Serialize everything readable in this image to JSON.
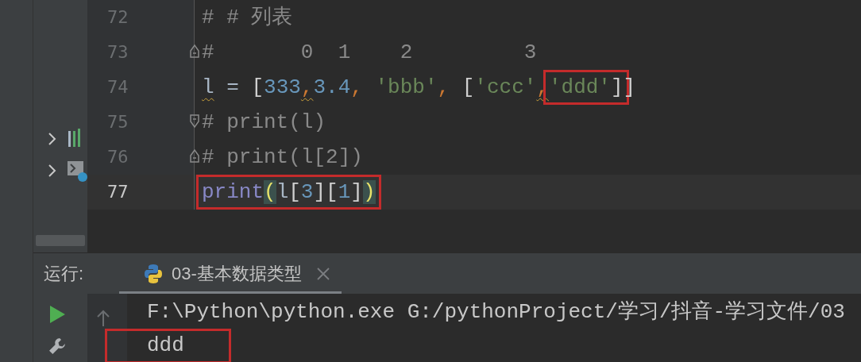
{
  "project_pane": {
    "rows": [
      {
        "kind": "chart",
        "expanded": false
      },
      {
        "kind": "console",
        "expanded": false
      }
    ]
  },
  "editor": {
    "lines": [
      {
        "number": "72",
        "current": false,
        "fold_start": false,
        "fold_end": false,
        "segments": [
          {
            "boxed": false,
            "tokens": [
              {
                "text": "# # 列表",
                "kind": "comment"
              }
            ]
          }
        ]
      },
      {
        "number": "73",
        "current": false,
        "fold_start": true,
        "fold_end": false,
        "segments": [
          {
            "boxed": false,
            "tokens": [
              {
                "text": "#       0  1    2         3",
                "kind": "comment"
              }
            ]
          }
        ]
      },
      {
        "number": "74",
        "current": false,
        "fold_start": false,
        "fold_end": false,
        "segments": [
          {
            "boxed": false,
            "tokens": [
              {
                "text": "l",
                "kind": "ident",
                "warning": true
              },
              {
                "text": " = ",
                "kind": "op"
              },
              {
                "text": "[",
                "kind": "bracket"
              },
              {
                "text": "333",
                "kind": "number"
              },
              {
                "text": ",",
                "kind": "comma",
                "warning": true
              },
              {
                "text": "3.4",
                "kind": "number"
              },
              {
                "text": ", ",
                "kind": "comma"
              },
              {
                "text": "'bbb'",
                "kind": "string"
              },
              {
                "text": ", ",
                "kind": "comma"
              },
              {
                "text": "[",
                "kind": "bracket"
              },
              {
                "text": "'ccc'",
                "kind": "string"
              },
              {
                "text": ",",
                "kind": "comma",
                "warning": true
              }
            ]
          },
          {
            "boxed": true,
            "tokens": [
              {
                "text": "'ddd'",
                "kind": "string"
              },
              {
                "text": "]",
                "kind": "bracket"
              }
            ]
          },
          {
            "boxed": false,
            "tokens": [
              {
                "text": "]",
                "kind": "bracket"
              }
            ]
          }
        ]
      },
      {
        "number": "75",
        "current": false,
        "fold_start": false,
        "fold_end": true,
        "segments": [
          {
            "boxed": false,
            "tokens": [
              {
                "text": "# print(l)",
                "kind": "comment"
              }
            ]
          }
        ]
      },
      {
        "number": "76",
        "current": false,
        "fold_start": true,
        "fold_end": false,
        "segments": [
          {
            "boxed": false,
            "tokens": [
              {
                "text": "# print(l[2])",
                "kind": "comment"
              }
            ]
          }
        ]
      },
      {
        "number": "77",
        "current": true,
        "fold_start": false,
        "fold_end": false,
        "segments": [
          {
            "boxed": true,
            "tokens": [
              {
                "text": "print",
                "kind": "builtin"
              },
              {
                "text": "(",
                "kind": "paren",
                "matched": true
              },
              {
                "text": "l",
                "kind": "ident"
              },
              {
                "text": "[",
                "kind": "bracket"
              },
              {
                "text": "3",
                "kind": "number"
              },
              {
                "text": "][",
                "kind": "bracket"
              },
              {
                "text": "1",
                "kind": "number"
              },
              {
                "text": "]",
                "kind": "bracket"
              },
              {
                "text": ")",
                "kind": "paren",
                "matched": true
              }
            ]
          }
        ]
      }
    ]
  },
  "run_panel": {
    "label": "运行:",
    "tabs": [
      {
        "title": "03-基本数据类型",
        "selected": true,
        "closable": true
      }
    ],
    "output": [
      {
        "text": "F:\\Python\\python.exe G:/pythonProject/学习/抖音-学习文件/03",
        "boxed": false
      },
      {
        "text": "ddd",
        "boxed": true
      }
    ]
  }
}
